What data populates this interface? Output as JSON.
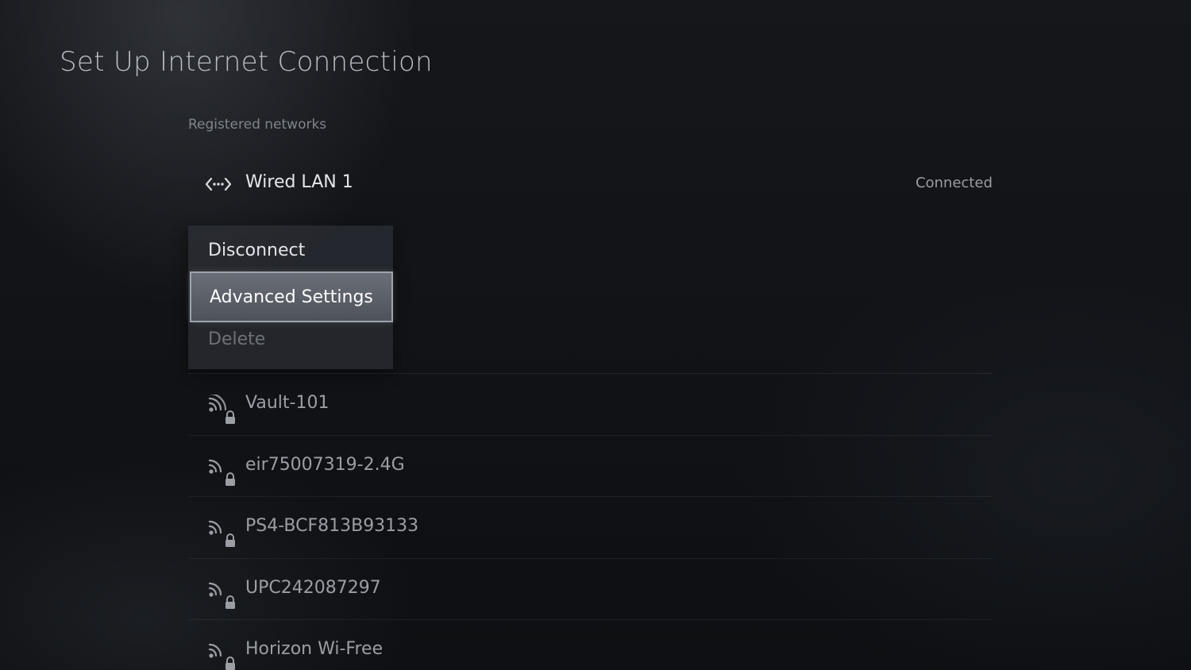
{
  "header": {
    "title": "Set Up Internet Connection"
  },
  "registered": {
    "label": "Registered networks",
    "wired": {
      "name": "Wired LAN 1",
      "status": "Connected",
      "icon": "wired-lan-icon"
    }
  },
  "context_menu": {
    "items": [
      {
        "label": "Disconnect",
        "state": "normal"
      },
      {
        "label": "Advanced Settings",
        "state": "focused"
      },
      {
        "label": "Delete",
        "state": "disabled"
      }
    ]
  },
  "networks": [
    {
      "name": "Vault-101",
      "icon": "wifi-locked-icon"
    },
    {
      "name": "eir75007319-2.4G",
      "icon": "wifi-locked-icon"
    },
    {
      "name": "PS4-BCF813B93133",
      "icon": "wifi-locked-icon"
    },
    {
      "name": "UPC242087297",
      "icon": "wifi-locked-icon"
    },
    {
      "name": "Horizon Wi-Free",
      "icon": "wifi-locked-icon"
    }
  ],
  "colors": {
    "background": "#0f1115",
    "focus_highlight": "#6a6e77",
    "text_primary": "#e6e7ea",
    "text_secondary": "#9b9ea4"
  }
}
